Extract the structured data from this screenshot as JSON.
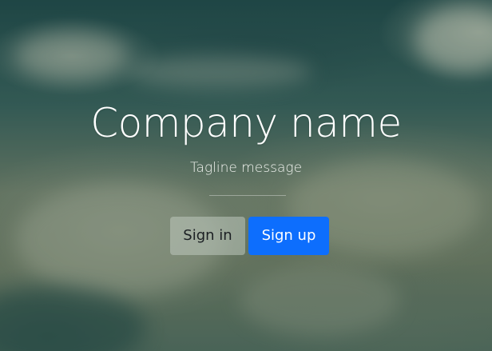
{
  "hero": {
    "title": "Company name",
    "tagline": "Tagline message"
  },
  "actions": {
    "signin_label": "Sign in",
    "signup_label": "Sign up"
  },
  "colors": {
    "primary": "#0d6efd",
    "text_light": "#ffffff"
  }
}
